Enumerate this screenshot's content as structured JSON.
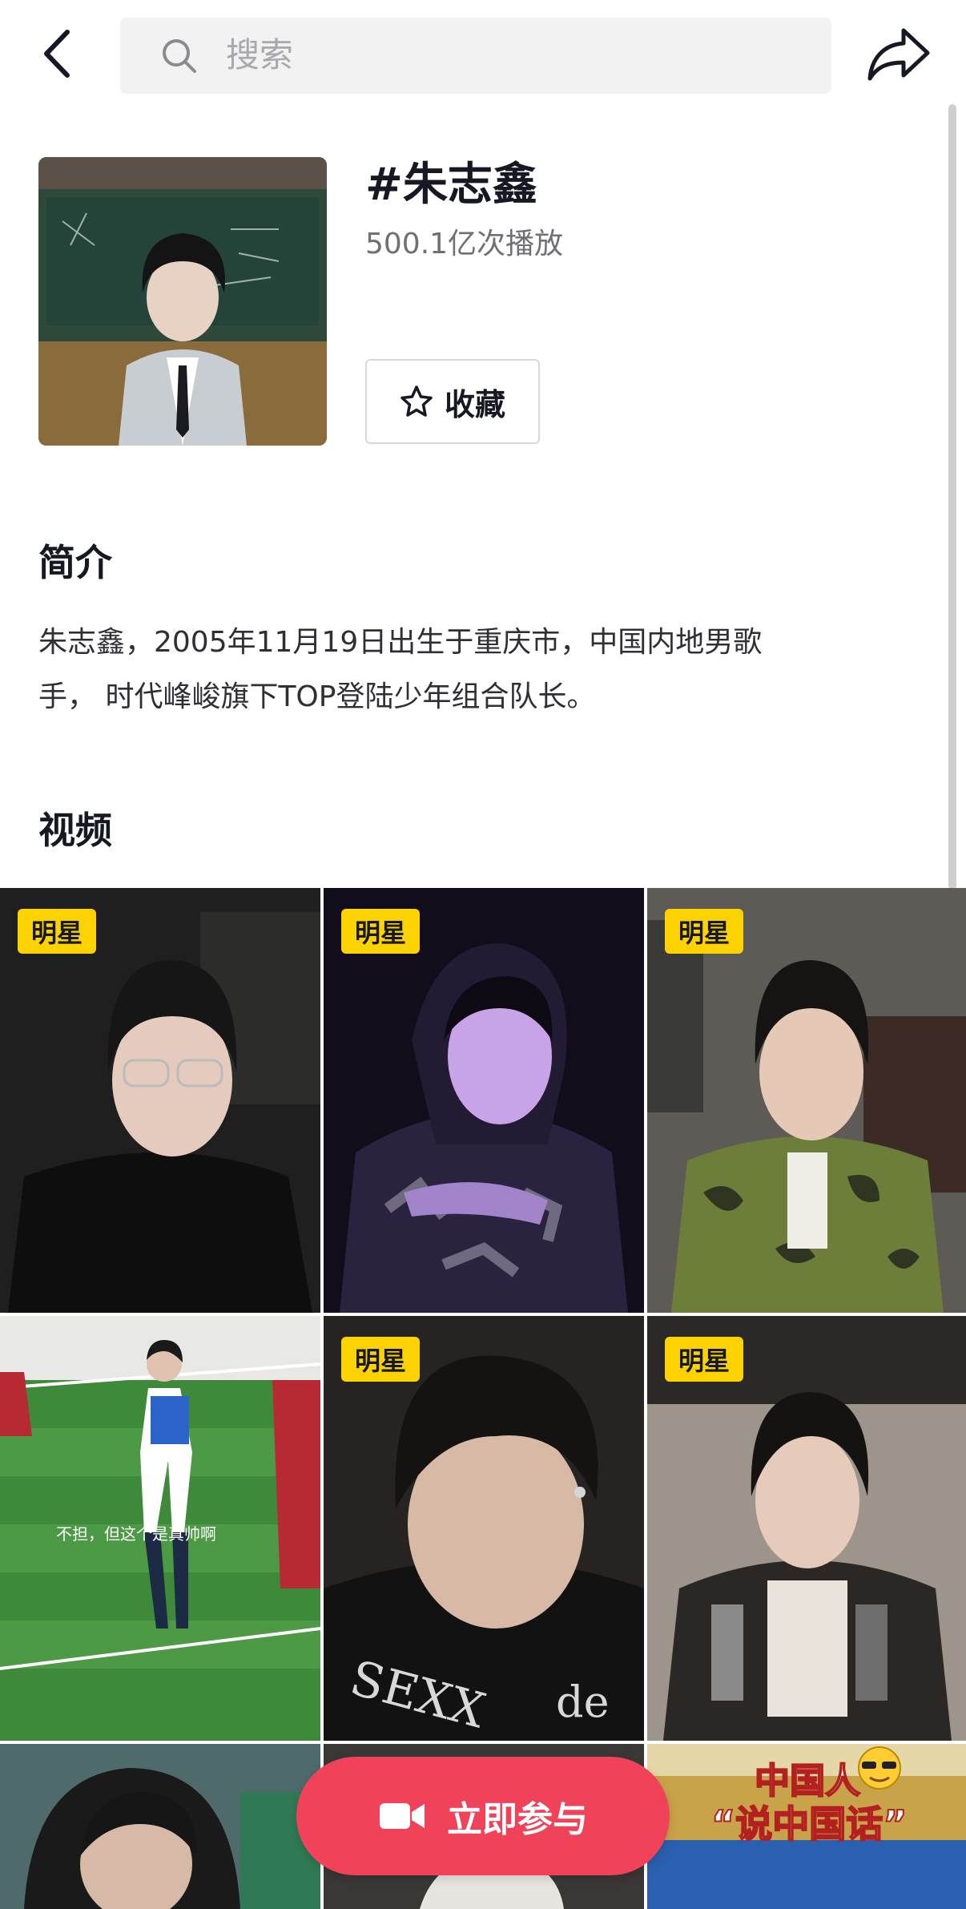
{
  "header": {
    "search_placeholder": "搜索"
  },
  "topic": {
    "title": "#朱志鑫",
    "play_count": "500.1亿次播放",
    "favorite_label": "收藏"
  },
  "intro": {
    "heading": "简介",
    "line1": "朱志鑫，2005年11月19日出生于重庆市，中国内地男歌",
    "line2": "手， 时代峰峻旗下TOP登陆少年组合队长。"
  },
  "videos": {
    "heading": "视频",
    "badge": "明星",
    "tile4_caption": "不担，但这个是真帅啊",
    "tile9_sticker_line1": "中国人",
    "tile9_sticker_line2": "“说中国话”"
  },
  "join_button": {
    "label": "立即参与"
  },
  "colors": {
    "accent": "#f0435a",
    "badge": "#fcd200"
  }
}
